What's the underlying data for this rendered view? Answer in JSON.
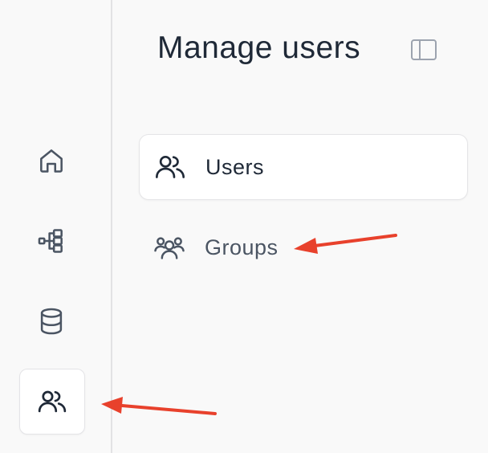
{
  "page": {
    "title": "Manage users"
  },
  "rail": {
    "items": [
      {
        "icon": "home-icon",
        "active": false
      },
      {
        "icon": "workflow-icon",
        "active": false
      },
      {
        "icon": "database-icon",
        "active": false
      },
      {
        "icon": "users-icon",
        "active": true
      }
    ]
  },
  "nav": {
    "items": [
      {
        "label": "Users",
        "icon": "users-icon",
        "active": true
      },
      {
        "label": "Groups",
        "icon": "groups-icon",
        "active": false
      }
    ]
  },
  "colors": {
    "annotation_arrow": "#e8412c",
    "text_primary": "#1f2937",
    "icon_gray": "#4b5563"
  }
}
